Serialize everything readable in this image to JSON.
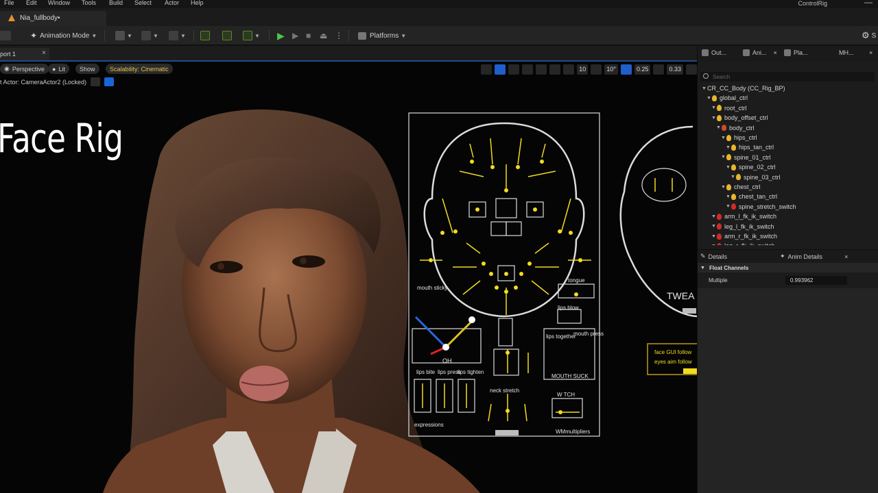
{
  "menu": {
    "items": [
      "File",
      "Edit",
      "Window",
      "Tools",
      "Build",
      "Select",
      "Actor",
      "Help"
    ],
    "window_title": "ControlRig"
  },
  "document_tab": {
    "label": "Nia_fullbody•"
  },
  "toolbar": {
    "mode_label": "Animation Mode",
    "platforms_label": "Platforms",
    "settings_label": "S"
  },
  "viewport": {
    "tab_label": "port 1",
    "view_type": "Perspective",
    "lighting": "Lit",
    "show": "Show",
    "scalability": "Scalability: Cinematic",
    "pilot_label": "t Actor: CameraActor2  (Locked)",
    "grid_value": "10",
    "angle_value": "10°",
    "scale_value": "0.25",
    "camera_speed": "0.33",
    "overlay_title": "Face Rig"
  },
  "rig_gui": {
    "mouth_sticky": "mouth sticky",
    "tongue": "tongue",
    "lips_blow": "lips blow",
    "oh": "OH",
    "lips_together": "lips together",
    "mouth_press": "mouth press",
    "mouth_suck": "MOUTH SUCK",
    "lips_bite": "lips bite",
    "lips_press": "lips press",
    "lips_tighten": "lips tighten",
    "neck_stretch": "neck stretch",
    "w_tch": "W TCH",
    "expressions": "expressions",
    "wm_multipliers": "WMmultipliers",
    "tweak": "TWEA",
    "face_gui_follow": "face GUI follow",
    "eyes_aim_follow": "eyes aim follow"
  },
  "right_panel": {
    "tabs": [
      "Out...",
      "Ani...",
      "Pla...",
      "MH..."
    ],
    "search_placeholder": "Search",
    "tree": [
      {
        "label": "CR_CC_Body  (CC_Rig_BP)",
        "depth": 0,
        "color": "none"
      },
      {
        "label": "global_ctrl",
        "depth": 1,
        "color": "#e8b62a"
      },
      {
        "label": "root_ctrl",
        "depth": 2,
        "color": "#e8b62a"
      },
      {
        "label": "body_offset_ctrl",
        "depth": 2,
        "color": "#e8b62a"
      },
      {
        "label": "body_ctrl",
        "depth": 3,
        "color": "#d14a2a"
      },
      {
        "label": "hips_ctrl",
        "depth": 4,
        "color": "#e8b62a"
      },
      {
        "label": "hips_tan_ctrl",
        "depth": 5,
        "color": "#e8b62a"
      },
      {
        "label": "spine_01_ctrl",
        "depth": 4,
        "color": "#e8b62a"
      },
      {
        "label": "spine_02_ctrl",
        "depth": 5,
        "color": "#e8b62a"
      },
      {
        "label": "spine_03_ctrl",
        "depth": 6,
        "color": "#e8b62a"
      },
      {
        "label": "chest_ctrl",
        "depth": 4,
        "color": "#e8b62a"
      },
      {
        "label": "chest_tan_ctrl",
        "depth": 5,
        "color": "#e8b62a"
      },
      {
        "label": "spine_stretch_switch",
        "depth": 5,
        "color": "#d12a2a"
      },
      {
        "label": "arm_l_fk_ik_switch",
        "depth": 2,
        "color": "#d12a2a"
      },
      {
        "label": "leg_l_fk_ik_switch",
        "depth": 2,
        "color": "#d12a2a"
      },
      {
        "label": "arm_r_fk_ik_switch",
        "depth": 2,
        "color": "#d12a2a"
      },
      {
        "label": "leg_r_fk_ik_switch",
        "depth": 2,
        "color": "#d12a2a"
      }
    ],
    "details_tab": "Details",
    "anim_details_tab": "Anim Details",
    "float_channels": "Float Channels",
    "multiple_label": "Multiple",
    "multiple_value": "0.993962"
  },
  "colors": {
    "accent_blue": "#1f5fcc",
    "rig_yellow": "#f2dc1e",
    "ue_orange": "#e3932b"
  }
}
